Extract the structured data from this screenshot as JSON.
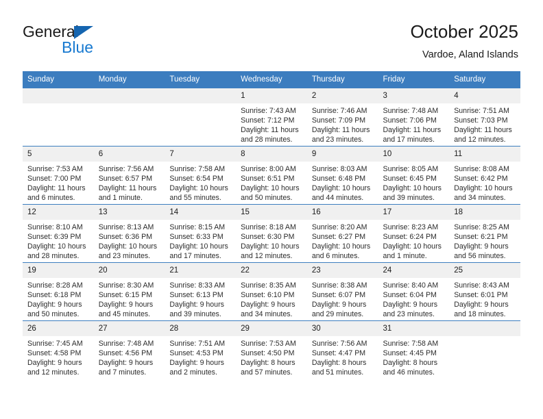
{
  "brand": {
    "name_part1": "General",
    "name_part2": "Blue",
    "logo_icon": "triangle-flag-icon"
  },
  "header": {
    "title": "October 2025",
    "subtitle": "Vardoe, Aland Islands"
  },
  "colors": {
    "header_blue": "#3C7DBF",
    "brand_blue": "#1779d0",
    "daynum_band": "#F0F0F0",
    "text": "#1a1a1a"
  },
  "weekday_headers": [
    "Sunday",
    "Monday",
    "Tuesday",
    "Wednesday",
    "Thursday",
    "Friday",
    "Saturday"
  ],
  "weeks": [
    [
      {
        "day": "",
        "empty": true,
        "lines": []
      },
      {
        "day": "",
        "empty": true,
        "lines": []
      },
      {
        "day": "",
        "empty": true,
        "lines": []
      },
      {
        "day": "1",
        "empty": false,
        "lines": [
          "Sunrise: 7:43 AM",
          "Sunset: 7:12 PM",
          "Daylight: 11 hours",
          "and 28 minutes."
        ]
      },
      {
        "day": "2",
        "empty": false,
        "lines": [
          "Sunrise: 7:46 AM",
          "Sunset: 7:09 PM",
          "Daylight: 11 hours",
          "and 23 minutes."
        ]
      },
      {
        "day": "3",
        "empty": false,
        "lines": [
          "Sunrise: 7:48 AM",
          "Sunset: 7:06 PM",
          "Daylight: 11 hours",
          "and 17 minutes."
        ]
      },
      {
        "day": "4",
        "empty": false,
        "lines": [
          "Sunrise: 7:51 AM",
          "Sunset: 7:03 PM",
          "Daylight: 11 hours",
          "and 12 minutes."
        ]
      }
    ],
    [
      {
        "day": "5",
        "empty": false,
        "lines": [
          "Sunrise: 7:53 AM",
          "Sunset: 7:00 PM",
          "Daylight: 11 hours",
          "and 6 minutes."
        ]
      },
      {
        "day": "6",
        "empty": false,
        "lines": [
          "Sunrise: 7:56 AM",
          "Sunset: 6:57 PM",
          "Daylight: 11 hours",
          "and 1 minute."
        ]
      },
      {
        "day": "7",
        "empty": false,
        "lines": [
          "Sunrise: 7:58 AM",
          "Sunset: 6:54 PM",
          "Daylight: 10 hours",
          "and 55 minutes."
        ]
      },
      {
        "day": "8",
        "empty": false,
        "lines": [
          "Sunrise: 8:00 AM",
          "Sunset: 6:51 PM",
          "Daylight: 10 hours",
          "and 50 minutes."
        ]
      },
      {
        "day": "9",
        "empty": false,
        "lines": [
          "Sunrise: 8:03 AM",
          "Sunset: 6:48 PM",
          "Daylight: 10 hours",
          "and 44 minutes."
        ]
      },
      {
        "day": "10",
        "empty": false,
        "lines": [
          "Sunrise: 8:05 AM",
          "Sunset: 6:45 PM",
          "Daylight: 10 hours",
          "and 39 minutes."
        ]
      },
      {
        "day": "11",
        "empty": false,
        "lines": [
          "Sunrise: 8:08 AM",
          "Sunset: 6:42 PM",
          "Daylight: 10 hours",
          "and 34 minutes."
        ]
      }
    ],
    [
      {
        "day": "12",
        "empty": false,
        "lines": [
          "Sunrise: 8:10 AM",
          "Sunset: 6:39 PM",
          "Daylight: 10 hours",
          "and 28 minutes."
        ]
      },
      {
        "day": "13",
        "empty": false,
        "lines": [
          "Sunrise: 8:13 AM",
          "Sunset: 6:36 PM",
          "Daylight: 10 hours",
          "and 23 minutes."
        ]
      },
      {
        "day": "14",
        "empty": false,
        "lines": [
          "Sunrise: 8:15 AM",
          "Sunset: 6:33 PM",
          "Daylight: 10 hours",
          "and 17 minutes."
        ]
      },
      {
        "day": "15",
        "empty": false,
        "lines": [
          "Sunrise: 8:18 AM",
          "Sunset: 6:30 PM",
          "Daylight: 10 hours",
          "and 12 minutes."
        ]
      },
      {
        "day": "16",
        "empty": false,
        "lines": [
          "Sunrise: 8:20 AM",
          "Sunset: 6:27 PM",
          "Daylight: 10 hours",
          "and 6 minutes."
        ]
      },
      {
        "day": "17",
        "empty": false,
        "lines": [
          "Sunrise: 8:23 AM",
          "Sunset: 6:24 PM",
          "Daylight: 10 hours",
          "and 1 minute."
        ]
      },
      {
        "day": "18",
        "empty": false,
        "lines": [
          "Sunrise: 8:25 AM",
          "Sunset: 6:21 PM",
          "Daylight: 9 hours",
          "and 56 minutes."
        ]
      }
    ],
    [
      {
        "day": "19",
        "empty": false,
        "lines": [
          "Sunrise: 8:28 AM",
          "Sunset: 6:18 PM",
          "Daylight: 9 hours",
          "and 50 minutes."
        ]
      },
      {
        "day": "20",
        "empty": false,
        "lines": [
          "Sunrise: 8:30 AM",
          "Sunset: 6:15 PM",
          "Daylight: 9 hours",
          "and 45 minutes."
        ]
      },
      {
        "day": "21",
        "empty": false,
        "lines": [
          "Sunrise: 8:33 AM",
          "Sunset: 6:13 PM",
          "Daylight: 9 hours",
          "and 39 minutes."
        ]
      },
      {
        "day": "22",
        "empty": false,
        "lines": [
          "Sunrise: 8:35 AM",
          "Sunset: 6:10 PM",
          "Daylight: 9 hours",
          "and 34 minutes."
        ]
      },
      {
        "day": "23",
        "empty": false,
        "lines": [
          "Sunrise: 8:38 AM",
          "Sunset: 6:07 PM",
          "Daylight: 9 hours",
          "and 29 minutes."
        ]
      },
      {
        "day": "24",
        "empty": false,
        "lines": [
          "Sunrise: 8:40 AM",
          "Sunset: 6:04 PM",
          "Daylight: 9 hours",
          "and 23 minutes."
        ]
      },
      {
        "day": "25",
        "empty": false,
        "lines": [
          "Sunrise: 8:43 AM",
          "Sunset: 6:01 PM",
          "Daylight: 9 hours",
          "and 18 minutes."
        ]
      }
    ],
    [
      {
        "day": "26",
        "empty": false,
        "lines": [
          "Sunrise: 7:45 AM",
          "Sunset: 4:58 PM",
          "Daylight: 9 hours",
          "and 12 minutes."
        ]
      },
      {
        "day": "27",
        "empty": false,
        "lines": [
          "Sunrise: 7:48 AM",
          "Sunset: 4:56 PM",
          "Daylight: 9 hours",
          "and 7 minutes."
        ]
      },
      {
        "day": "28",
        "empty": false,
        "lines": [
          "Sunrise: 7:51 AM",
          "Sunset: 4:53 PM",
          "Daylight: 9 hours",
          "and 2 minutes."
        ]
      },
      {
        "day": "29",
        "empty": false,
        "lines": [
          "Sunrise: 7:53 AM",
          "Sunset: 4:50 PM",
          "Daylight: 8 hours",
          "and 57 minutes."
        ]
      },
      {
        "day": "30",
        "empty": false,
        "lines": [
          "Sunrise: 7:56 AM",
          "Sunset: 4:47 PM",
          "Daylight: 8 hours",
          "and 51 minutes."
        ]
      },
      {
        "day": "31",
        "empty": false,
        "lines": [
          "Sunrise: 7:58 AM",
          "Sunset: 4:45 PM",
          "Daylight: 8 hours",
          "and 46 minutes."
        ]
      },
      {
        "day": "",
        "empty": true,
        "lines": []
      }
    ]
  ]
}
